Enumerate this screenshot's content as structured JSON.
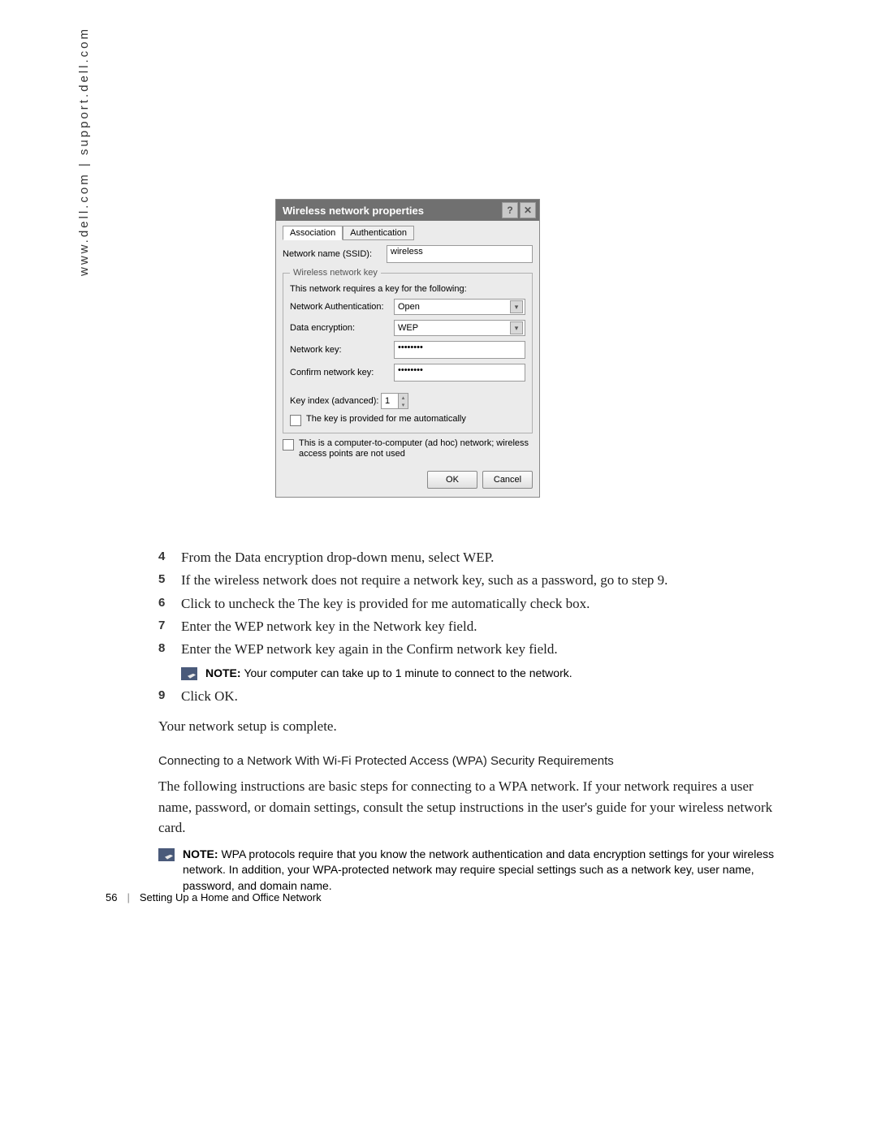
{
  "sidebar": {
    "url_text": "www.dell.com | support.dell.com"
  },
  "dialog": {
    "title": "Wireless network properties",
    "help_glyph": "?",
    "close_glyph": "✕",
    "tabs": {
      "association": "Association",
      "authentication": "Authentication"
    },
    "ssid_label": "Network name (SSID):",
    "ssid_value": "wireless",
    "group_legend": "Wireless network key",
    "group_desc": "This network requires a key for the following:",
    "auth_label": "Network Authentication:",
    "auth_value": "Open",
    "enc_label": "Data encryption:",
    "enc_value": "WEP",
    "key_label": "Network key:",
    "key_value": "••••••••",
    "confirmkey_label": "Confirm network key:",
    "confirmkey_value": "••••••••",
    "keyindex_label": "Key index (advanced):",
    "keyindex_value": "1",
    "auto_label": "The key is provided for me automatically",
    "adhoc_label": "This is a computer-to-computer (ad hoc) network; wireless access points are not used",
    "ok": "OK",
    "cancel": "Cancel"
  },
  "steps": {
    "s4": "From the Data encryption drop-down menu, select WEP.",
    "s5": "If the wireless network does not require a network key, such as a password, go to step 9.",
    "s6": "Click to uncheck the The key is provided for me automatically check box.",
    "s7": "Enter the WEP network key in the Network key field.",
    "s8": "Enter the WEP network key again in the Confirm network key field.",
    "s9": "Click OK."
  },
  "notes": {
    "note1_prefix": "NOTE: ",
    "note1_body": "Your computer can take up to 1 minute to connect to the network.",
    "note2_prefix": "NOTE: ",
    "note2_body": "WPA protocols require that you know the network authentication and data encryption settings for your wireless network. In addition, your WPA-protected network may require special settings such as a network key, user name, password, and domain name."
  },
  "text": {
    "complete": "Your network setup is complete.",
    "subhead": "Connecting to a Network With Wi-Fi Protected Access (WPA) Security Requirements",
    "wpa_para": "The following instructions are basic steps for connecting to a WPA network. If your network requires a user name, password, or domain settings, consult the setup instructions in the user's guide for your wireless network card."
  },
  "footer": {
    "page": "56",
    "divider": "|",
    "section": "Setting Up a Home and Office Network"
  }
}
